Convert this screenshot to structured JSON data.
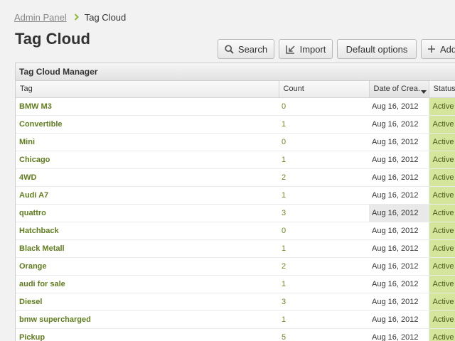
{
  "breadcrumb": {
    "parent": "Admin Panel",
    "current": "Tag Cloud"
  },
  "page_title": "Tag Cloud",
  "toolbar": {
    "search": "Search",
    "import": "Import",
    "default_options": "Default options",
    "add": "Add"
  },
  "panel": {
    "title": "Tag Cloud Manager",
    "columns": {
      "tag": "Tag",
      "count": "Count",
      "date": "Date of Crea.",
      "status": "Status"
    },
    "rows": [
      {
        "tag": "BMW M3",
        "count": "0",
        "date": "Aug 16, 2012",
        "status": "Active"
      },
      {
        "tag": "Convertible",
        "count": "1",
        "date": "Aug 16, 2012",
        "status": "Active"
      },
      {
        "tag": "Mini",
        "count": "0",
        "date": "Aug 16, 2012",
        "status": "Active"
      },
      {
        "tag": "Chicago",
        "count": "1",
        "date": "Aug 16, 2012",
        "status": "Active"
      },
      {
        "tag": "4WD",
        "count": "2",
        "date": "Aug 16, 2012",
        "status": "Active"
      },
      {
        "tag": "Audi A7",
        "count": "1",
        "date": "Aug 16, 2012",
        "status": "Active"
      },
      {
        "tag": "quattro",
        "count": "3",
        "date": "Aug 16, 2012",
        "status": "Active"
      },
      {
        "tag": "Hatchback",
        "count": "0",
        "date": "Aug 16, 2012",
        "status": "Active"
      },
      {
        "tag": "Black Metall",
        "count": "1",
        "date": "Aug 16, 2012",
        "status": "Active"
      },
      {
        "tag": "Orange",
        "count": "2",
        "date": "Aug 16, 2012",
        "status": "Active"
      },
      {
        "tag": "audi for sale",
        "count": "1",
        "date": "Aug 16, 2012",
        "status": "Active"
      },
      {
        "tag": "Diesel",
        "count": "3",
        "date": "Aug 16, 2012",
        "status": "Active"
      },
      {
        "tag": "bmw supercharged",
        "count": "1",
        "date": "Aug 16, 2012",
        "status": "Active"
      },
      {
        "tag": "Pickup",
        "count": "5",
        "date": "Aug 16, 2012",
        "status": "Active"
      }
    ]
  },
  "icons": {
    "breadcrumb_separator": "chevron-right-icon",
    "search": "magnifier-icon",
    "import": "import-icon",
    "add": "plus-icon",
    "sort": "sort-down-icon"
  },
  "colors": {
    "tag_text": "#5f7d1d",
    "count_text": "#6b8a22",
    "status_bg": "#d5e59b",
    "breadcrumb_chevron": "#8fb63c",
    "row_highlight": "#e9e9e9"
  }
}
